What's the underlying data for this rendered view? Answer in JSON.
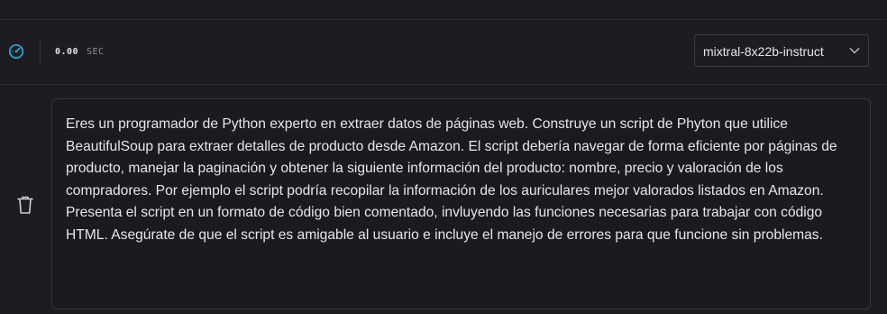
{
  "toolbar": {
    "speed_icon": "speedometer-icon",
    "time_value": "0.00",
    "time_unit": "SEC",
    "model_select": {
      "selected": "mixtral-8x22b-instruct",
      "chevron_icon": "chevron-down-icon"
    }
  },
  "message": {
    "delete_icon": "trash-icon",
    "text": "Eres un programador de Python experto en extraer datos de páginas web. Construye un script de Phyton que utilice BeautifulSoup para extraer detalles de producto desde Amazon. El script debería navegar de forma eficiente por páginas de producto, manejar la paginación y obtener la siguiente información del producto: nombre, precio y valoración de los compradores. Por ejemplo el script podría recopilar la información de los auriculares mejor valorados listados en Amazon. Presenta el script en un formato de código bien comentado, invluyendo las funciones necesarias para trabajar con código HTML. Asegúrate de que el script es amigable al usuario e incluye el manejo de errores para que funcione sin problemas.",
    "send_icon": "arrow-up-icon"
  },
  "colors": {
    "background": "#1d1d21",
    "accent": "#1c8fc4",
    "text": "#e7e7ea",
    "border": "#34343a"
  }
}
